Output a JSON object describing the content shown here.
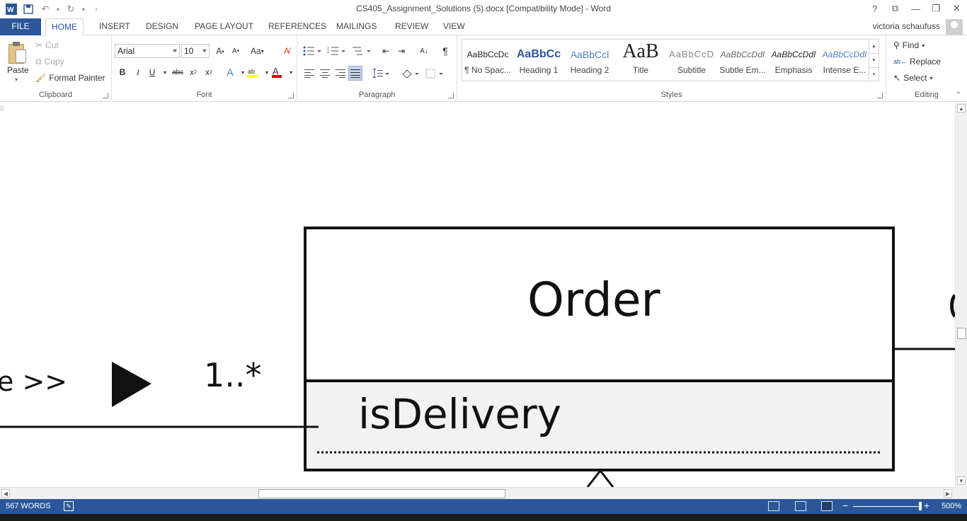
{
  "titlebar": {
    "title": "CS405_Assignment_Solutions (5).docx [Compatibility Mode] - Word",
    "help": "?"
  },
  "tabs": [
    "FILE",
    "HOME",
    "INSERT",
    "DESIGN",
    "PAGE LAYOUT",
    "REFERENCES",
    "MAILINGS",
    "REVIEW",
    "VIEW"
  ],
  "user": "victoria schaufuss",
  "clipboard": {
    "paste": "Paste",
    "cut": "Cut",
    "copy": "Copy",
    "format_painter": "Format Painter",
    "label": "Clipboard"
  },
  "font": {
    "name": "Arial",
    "size": "10",
    "case": "Aa",
    "label": "Font"
  },
  "paragraph": {
    "label": "Paragraph"
  },
  "styles": {
    "label": "Styles",
    "items": [
      {
        "sample": "AaBbCcDc",
        "name": "¶ No Spac..."
      },
      {
        "sample": "AaBbCc",
        "name": "Heading 1"
      },
      {
        "sample": "AaBbCcl",
        "name": "Heading 2"
      },
      {
        "sample": "AaB",
        "name": "Title"
      },
      {
        "sample": "AaBbCcD",
        "name": "Subtitle"
      },
      {
        "sample": "AaBbCcDdI",
        "name": "Subtle Em..."
      },
      {
        "sample": "AaBbCcDdI",
        "name": "Emphasis"
      },
      {
        "sample": "AaBbCcDdI",
        "name": "Intense E..."
      }
    ]
  },
  "editing": {
    "find": "Find",
    "replace": "Replace",
    "select": "Select",
    "label": "Editing"
  },
  "diagram": {
    "class_name": "Order",
    "attribute": "isDelivery",
    "left_stereotype_fragment": "e >>",
    "multiplicity": "1..*"
  },
  "status": {
    "words": "567 WORDS",
    "zoom": "500%"
  }
}
